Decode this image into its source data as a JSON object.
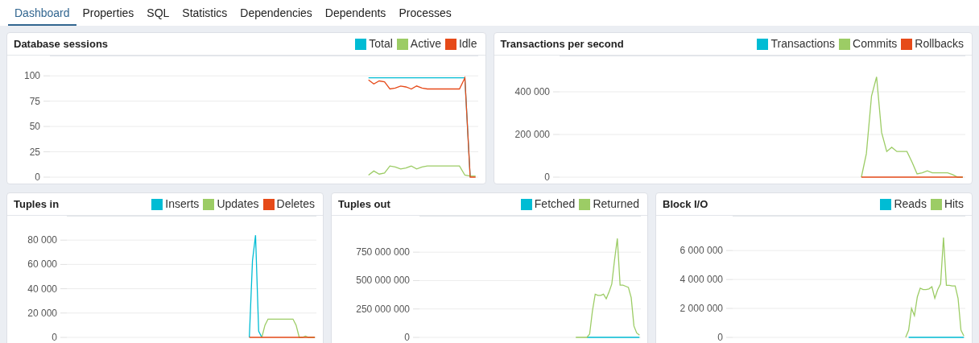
{
  "tabs": [
    {
      "label": "Dashboard",
      "selected": true
    },
    {
      "label": "Properties",
      "selected": false
    },
    {
      "label": "SQL",
      "selected": false
    },
    {
      "label": "Statistics",
      "selected": false
    },
    {
      "label": "Dependencies",
      "selected": false
    },
    {
      "label": "Dependents",
      "selected": false
    },
    {
      "label": "Processes",
      "selected": false
    }
  ],
  "rows": [
    {
      "panels": [
        {
          "title": "Database sessions",
          "chart_data": {
            "type": "line",
            "grid": true,
            "categories": [
              null,
              null,
              null,
              null,
              null,
              null,
              null,
              null,
              null,
              null,
              null,
              null,
              null,
              null,
              null,
              null,
              null,
              null,
              null,
              null,
              null,
              null,
              null,
              null,
              null,
              null,
              null,
              null,
              null,
              null,
              null,
              null,
              null,
              null,
              null,
              null,
              null,
              null,
              null,
              null,
              null,
              null,
              null,
              null,
              null,
              null,
              null,
              null,
              null,
              null,
              null,
              null,
              null,
              null,
              null,
              null,
              null,
              null,
              null,
              null,
              null,
              null,
              null,
              null,
              null,
              null,
              null,
              null,
              null,
              null,
              null,
              null,
              null,
              null,
              null,
              null,
              null,
              null,
              null,
              null
            ],
            "ylim": [
              0,
              120
            ],
            "yticks": [
              {
                "value": 0,
                "label": "0"
              },
              {
                "value": 25,
                "label": "25"
              },
              {
                "value": 50,
                "label": "50"
              },
              {
                "value": 75,
                "label": "75"
              },
              {
                "value": 100,
                "label": "100"
              }
            ],
            "series": [
              {
                "name": "Total",
                "color": "#00bcd4",
                "values": [
                  null,
                  null,
                  null,
                  null,
                  null,
                  null,
                  null,
                  null,
                  null,
                  null,
                  null,
                  null,
                  null,
                  null,
                  null,
                  null,
                  null,
                  null,
                  null,
                  null,
                  null,
                  null,
                  null,
                  null,
                  null,
                  null,
                  null,
                  null,
                  null,
                  null,
                  null,
                  null,
                  null,
                  null,
                  null,
                  null,
                  null,
                  null,
                  null,
                  null,
                  null,
                  null,
                  null,
                  null,
                  null,
                  null,
                  null,
                  null,
                  null,
                  null,
                  null,
                  null,
                  null,
                  null,
                  null,
                  null,
                  null,
                  null,
                  null,
                  98,
                  98,
                  98,
                  98,
                  98,
                  98,
                  98,
                  98,
                  98,
                  98,
                  98,
                  98,
                  98,
                  98,
                  98,
                  98,
                  98,
                  98,
                  98,
                  0,
                  null
                ]
              },
              {
                "name": "Active",
                "color": "#9ccc65",
                "values": [
                  null,
                  null,
                  null,
                  null,
                  null,
                  null,
                  null,
                  null,
                  null,
                  null,
                  null,
                  null,
                  null,
                  null,
                  null,
                  null,
                  null,
                  null,
                  null,
                  null,
                  null,
                  null,
                  null,
                  null,
                  null,
                  null,
                  null,
                  null,
                  null,
                  null,
                  null,
                  null,
                  null,
                  null,
                  null,
                  null,
                  null,
                  null,
                  null,
                  null,
                  null,
                  null,
                  null,
                  null,
                  null,
                  null,
                  null,
                  null,
                  null,
                  null,
                  null,
                  null,
                  null,
                  null,
                  null,
                  null,
                  null,
                  null,
                  null,
                  2,
                  6,
                  3,
                  4,
                  11,
                  10,
                  8,
                  9,
                  11,
                  8,
                  10,
                  11,
                  11,
                  11,
                  11,
                  11,
                  11,
                  11,
                  2,
                  1,
                  1
                ]
              },
              {
                "name": "Idle",
                "color": "#e64a19",
                "values": [
                  null,
                  null,
                  null,
                  null,
                  null,
                  null,
                  null,
                  null,
                  null,
                  null,
                  null,
                  null,
                  null,
                  null,
                  null,
                  null,
                  null,
                  null,
                  null,
                  null,
                  null,
                  null,
                  null,
                  null,
                  null,
                  null,
                  null,
                  null,
                  null,
                  null,
                  null,
                  null,
                  null,
                  null,
                  null,
                  null,
                  null,
                  null,
                  null,
                  null,
                  null,
                  null,
                  null,
                  null,
                  null,
                  null,
                  null,
                  null,
                  null,
                  null,
                  null,
                  null,
                  null,
                  null,
                  null,
                  null,
                  null,
                  null,
                  null,
                  96,
                  92,
                  95,
                  94,
                  87,
                  88,
                  90,
                  89,
                  87,
                  90,
                  88,
                  87,
                  87,
                  87,
                  87,
                  87,
                  87,
                  87,
                  98,
                  0,
                  0
                ]
              }
            ]
          }
        },
        {
          "title": "Transactions per second",
          "chart_data": {
            "type": "line",
            "grid": true,
            "categories": [
              null,
              null,
              null,
              null,
              null,
              null,
              null,
              null,
              null,
              null,
              null,
              null,
              null,
              null,
              null,
              null,
              null,
              null,
              null,
              null,
              null,
              null,
              null,
              null,
              null,
              null,
              null,
              null,
              null,
              null,
              null,
              null,
              null,
              null,
              null,
              null,
              null,
              null,
              null,
              null,
              null,
              null,
              null,
              null,
              null,
              null,
              null,
              null,
              null,
              null,
              null,
              null,
              null,
              null,
              null,
              null,
              null,
              null,
              null,
              null,
              null,
              null,
              null,
              null,
              null,
              null,
              null,
              null,
              null,
              null,
              null,
              null,
              null,
              null,
              null,
              null,
              null,
              null,
              null,
              null
            ],
            "ylim": [
              0,
              570000
            ],
            "yticks": [
              {
                "value": 0,
                "label": "0"
              },
              {
                "value": 200000,
                "label": "200 000"
              },
              {
                "value": 400000,
                "label": "400 000"
              }
            ],
            "series": [
              {
                "name": "Transactions",
                "color": "#00bcd4",
                "values": [
                  null,
                  null,
                  null,
                  null,
                  null,
                  null,
                  null,
                  null,
                  null,
                  null,
                  null,
                  null,
                  null,
                  null,
                  null,
                  null,
                  null,
                  null,
                  null,
                  null,
                  null,
                  null,
                  null,
                  null,
                  null,
                  null,
                  null,
                  null,
                  null,
                  null,
                  null,
                  null,
                  null,
                  null,
                  null,
                  null,
                  null,
                  null,
                  null,
                  null,
                  null,
                  null,
                  null,
                  null,
                  null,
                  null,
                  null,
                  null,
                  null,
                  null,
                  null,
                  null,
                  null,
                  null,
                  null,
                  null,
                  null,
                  null,
                  null,
                  null,
                  null,
                  null,
                  null,
                  null,
                  null,
                  null,
                  null,
                  null,
                  null,
                  null,
                  null,
                  null,
                  null,
                  null,
                  null,
                  null,
                  null,
                  null,
                  null,
                  null
                ]
              },
              {
                "name": "Commits",
                "color": "#9ccc65",
                "values": [
                  null,
                  null,
                  null,
                  null,
                  null,
                  null,
                  null,
                  null,
                  null,
                  null,
                  null,
                  null,
                  null,
                  null,
                  null,
                  null,
                  null,
                  null,
                  null,
                  null,
                  null,
                  null,
                  null,
                  null,
                  null,
                  null,
                  null,
                  null,
                  null,
                  null,
                  null,
                  null,
                  null,
                  null,
                  null,
                  null,
                  null,
                  null,
                  null,
                  null,
                  null,
                  null,
                  null,
                  null,
                  null,
                  null,
                  null,
                  null,
                  null,
                  null,
                  null,
                  null,
                  null,
                  null,
                  null,
                  null,
                  null,
                  null,
                  null,
                  0,
                  110000,
                  380000,
                  470000,
                  210000,
                  120000,
                  140000,
                  120000,
                  120000,
                  120000,
                  70000,
                  15000,
                  20000,
                  30000,
                  20000,
                  20000,
                  20000,
                  20000,
                  12000,
                  0,
                  0
                ]
              },
              {
                "name": "Rollbacks",
                "color": "#e64a19",
                "values": [
                  null,
                  null,
                  null,
                  null,
                  null,
                  null,
                  null,
                  null,
                  null,
                  null,
                  null,
                  null,
                  null,
                  null,
                  null,
                  null,
                  null,
                  null,
                  null,
                  null,
                  null,
                  null,
                  null,
                  null,
                  null,
                  null,
                  null,
                  null,
                  null,
                  null,
                  null,
                  null,
                  null,
                  null,
                  null,
                  null,
                  null,
                  null,
                  null,
                  null,
                  null,
                  null,
                  null,
                  null,
                  null,
                  null,
                  null,
                  null,
                  null,
                  null,
                  null,
                  null,
                  null,
                  null,
                  null,
                  null,
                  null,
                  null,
                  null,
                  0,
                  0,
                  0,
                  0,
                  0,
                  0,
                  0,
                  0,
                  0,
                  0,
                  0,
                  0,
                  0,
                  0,
                  0,
                  0,
                  0,
                  0,
                  0,
                  0,
                  0
                ]
              }
            ]
          }
        }
      ]
    },
    {
      "panels": [
        {
          "title": "Tuples in",
          "chart_data": {
            "type": "line",
            "grid": true,
            "categories": [
              null,
              null,
              null,
              null,
              null,
              null,
              null,
              null,
              null,
              null,
              null,
              null,
              null,
              null,
              null,
              null,
              null,
              null,
              null,
              null,
              null,
              null,
              null,
              null,
              null,
              null,
              null,
              null,
              null,
              null,
              null,
              null,
              null,
              null,
              null,
              null,
              null,
              null,
              null,
              null,
              null,
              null,
              null,
              null,
              null,
              null,
              null,
              null,
              null,
              null,
              null,
              null,
              null,
              null,
              null,
              null,
              null,
              null,
              null,
              null,
              null,
              null,
              null,
              null,
              null,
              null,
              null,
              null,
              null,
              null,
              null,
              null,
              null,
              null,
              null,
              null,
              null,
              null,
              null,
              null
            ],
            "ylim": [
              0,
              100000
            ],
            "yticks": [
              {
                "value": 0,
                "label": "0"
              },
              {
                "value": 20000,
                "label": "20 000"
              },
              {
                "value": 40000,
                "label": "40 000"
              },
              {
                "value": 60000,
                "label": "60 000"
              },
              {
                "value": 80000,
                "label": "80 000"
              }
            ],
            "series": [
              {
                "name": "Inserts",
                "color": "#00bcd4",
                "values": [
                  null,
                  null,
                  null,
                  null,
                  null,
                  null,
                  null,
                  null,
                  null,
                  null,
                  null,
                  null,
                  null,
                  null,
                  null,
                  null,
                  null,
                  null,
                  null,
                  null,
                  null,
                  null,
                  null,
                  null,
                  null,
                  null,
                  null,
                  null,
                  null,
                  null,
                  null,
                  null,
                  null,
                  null,
                  null,
                  null,
                  null,
                  null,
                  null,
                  null,
                  null,
                  null,
                  null,
                  null,
                  null,
                  null,
                  null,
                  null,
                  null,
                  null,
                  null,
                  null,
                  null,
                  null,
                  null,
                  null,
                  null,
                  null,
                  0,
                  63000,
                  84000,
                  5000,
                  0,
                  null,
                  null,
                  null,
                  null,
                  null,
                  null,
                  null,
                  null,
                  null,
                  null,
                  null,
                  null,
                  null,
                  null,
                  null,
                  null,
                  null
                ]
              },
              {
                "name": "Updates",
                "color": "#9ccc65",
                "values": [
                  null,
                  null,
                  null,
                  null,
                  null,
                  null,
                  null,
                  null,
                  null,
                  null,
                  null,
                  null,
                  null,
                  null,
                  null,
                  null,
                  null,
                  null,
                  null,
                  null,
                  null,
                  null,
                  null,
                  null,
                  null,
                  null,
                  null,
                  null,
                  null,
                  null,
                  null,
                  null,
                  null,
                  null,
                  null,
                  null,
                  null,
                  null,
                  null,
                  null,
                  null,
                  null,
                  null,
                  null,
                  null,
                  null,
                  null,
                  null,
                  null,
                  null,
                  null,
                  null,
                  null,
                  null,
                  null,
                  null,
                  null,
                  null,
                  null,
                  null,
                  null,
                  null,
                  0,
                  10000,
                  15000,
                  15000,
                  15000,
                  15000,
                  15000,
                  15000,
                  15000,
                  15000,
                  15000,
                  10000,
                  0,
                  0,
                  1000,
                  0,
                  0,
                  0
                ]
              },
              {
                "name": "Deletes",
                "color": "#e64a19",
                "values": [
                  null,
                  null,
                  null,
                  null,
                  null,
                  null,
                  null,
                  null,
                  null,
                  null,
                  null,
                  null,
                  null,
                  null,
                  null,
                  null,
                  null,
                  null,
                  null,
                  null,
                  null,
                  null,
                  null,
                  null,
                  null,
                  null,
                  null,
                  null,
                  null,
                  null,
                  null,
                  null,
                  null,
                  null,
                  null,
                  null,
                  null,
                  null,
                  null,
                  null,
                  null,
                  null,
                  null,
                  null,
                  null,
                  null,
                  null,
                  null,
                  null,
                  null,
                  null,
                  null,
                  null,
                  null,
                  null,
                  null,
                  null,
                  null,
                  0,
                  0,
                  0,
                  0,
                  0,
                  0,
                  0,
                  0,
                  0,
                  0,
                  0,
                  0,
                  0,
                  0,
                  0,
                  0,
                  0,
                  0,
                  0,
                  0,
                  0,
                  0
                ]
              }
            ]
          }
        },
        {
          "title": "Tuples out",
          "chart_data": {
            "type": "line",
            "grid": true,
            "categories": [
              null,
              null,
              null,
              null,
              null,
              null,
              null,
              null,
              null,
              null,
              null,
              null,
              null,
              null,
              null,
              null,
              null,
              null,
              null,
              null,
              null,
              null,
              null,
              null,
              null,
              null,
              null,
              null,
              null,
              null,
              null,
              null,
              null,
              null,
              null,
              null,
              null,
              null,
              null,
              null,
              null,
              null,
              null,
              null,
              null,
              null,
              null,
              null,
              null,
              null,
              null,
              null,
              null,
              null,
              null,
              null,
              null,
              null,
              null,
              null,
              null,
              null,
              null,
              null,
              null,
              null,
              null,
              null,
              null,
              null,
              null,
              null,
              null,
              null,
              null,
              null,
              null,
              null,
              null,
              null
            ],
            "ylim": [
              0,
              1070000000
            ],
            "yticks": [
              {
                "value": 0,
                "label": "0"
              },
              {
                "value": 250000000,
                "label": "250 000 000"
              },
              {
                "value": 500000000,
                "label": "500 000 000"
              },
              {
                "value": 750000000,
                "label": "750 000 000"
              }
            ],
            "series": [
              {
                "name": "Fetched",
                "color": "#00bcd4",
                "values": [
                  null,
                  null,
                  null,
                  null,
                  null,
                  null,
                  null,
                  null,
                  null,
                  null,
                  null,
                  null,
                  null,
                  null,
                  null,
                  null,
                  null,
                  null,
                  null,
                  null,
                  null,
                  null,
                  null,
                  null,
                  null,
                  null,
                  null,
                  null,
                  null,
                  null,
                  null,
                  null,
                  null,
                  null,
                  null,
                  null,
                  null,
                  null,
                  null,
                  null,
                  null,
                  null,
                  null,
                  null,
                  null,
                  null,
                  null,
                  null,
                  null,
                  null,
                  null,
                  null,
                  null,
                  null,
                  null,
                  null,
                  null,
                  null,
                  null,
                  null,
                  0,
                  0,
                  0,
                  0,
                  0,
                  0,
                  0,
                  0,
                  0,
                  0,
                  0,
                  0,
                  0,
                  0,
                  0,
                  0,
                  0,
                  0,
                  0,
                  0
                ]
              },
              {
                "name": "Returned",
                "color": "#9ccc65",
                "values": [
                  null,
                  null,
                  null,
                  null,
                  null,
                  null,
                  null,
                  null,
                  null,
                  null,
                  null,
                  null,
                  null,
                  null,
                  null,
                  null,
                  null,
                  null,
                  null,
                  null,
                  null,
                  null,
                  null,
                  null,
                  null,
                  null,
                  null,
                  null,
                  null,
                  null,
                  null,
                  null,
                  null,
                  null,
                  null,
                  null,
                  null,
                  null,
                  null,
                  null,
                  null,
                  null,
                  null,
                  null,
                  null,
                  null,
                  null,
                  null,
                  null,
                  null,
                  null,
                  null,
                  null,
                  null,
                  null,
                  null,
                  0,
                  0,
                  0,
                  0,
                  0,
                  30000000,
                  230000000,
                  380000000,
                  370000000,
                  370000000,
                  380000000,
                  340000000,
                  400000000,
                  470000000,
                  680000000,
                  870000000,
                  460000000,
                  460000000,
                  450000000,
                  440000000,
                  350000000,
                  100000000,
                  40000000,
                  20000000
                ]
              }
            ]
          }
        },
        {
          "title": "Block I/O",
          "chart_data": {
            "type": "line",
            "grid": true,
            "categories": [
              null,
              null,
              null,
              null,
              null,
              null,
              null,
              null,
              null,
              null,
              null,
              null,
              null,
              null,
              null,
              null,
              null,
              null,
              null,
              null,
              null,
              null,
              null,
              null,
              null,
              null,
              null,
              null,
              null,
              null,
              null,
              null,
              null,
              null,
              null,
              null,
              null,
              null,
              null,
              null,
              null,
              null,
              null,
              null,
              null,
              null,
              null,
              null,
              null,
              null,
              null,
              null,
              null,
              null,
              null,
              null,
              null,
              null,
              null,
              null,
              null,
              null,
              null,
              null,
              null,
              null,
              null,
              null,
              null,
              null,
              null,
              null,
              null,
              null,
              null,
              null,
              null,
              null,
              null,
              null
            ],
            "ylim": [
              0,
              8400000
            ],
            "yticks": [
              {
                "value": 0,
                "label": "0"
              },
              {
                "value": 2000000,
                "label": "2 000 000"
              },
              {
                "value": 4000000,
                "label": "4 000 000"
              },
              {
                "value": 6000000,
                "label": "6 000 000"
              }
            ],
            "series": [
              {
                "name": "Reads",
                "color": "#00bcd4",
                "values": [
                  null,
                  null,
                  null,
                  null,
                  null,
                  null,
                  null,
                  null,
                  null,
                  null,
                  null,
                  null,
                  null,
                  null,
                  null,
                  null,
                  null,
                  null,
                  null,
                  null,
                  null,
                  null,
                  null,
                  null,
                  null,
                  null,
                  null,
                  null,
                  null,
                  null,
                  null,
                  null,
                  null,
                  null,
                  null,
                  null,
                  null,
                  null,
                  null,
                  null,
                  null,
                  null,
                  null,
                  null,
                  null,
                  null,
                  null,
                  null,
                  null,
                  null,
                  null,
                  null,
                  null,
                  null,
                  null,
                  null,
                  null,
                  null,
                  null,
                  null,
                  0,
                  0,
                  0,
                  0,
                  0,
                  0,
                  0,
                  0,
                  0,
                  0,
                  0,
                  0,
                  0,
                  0,
                  0,
                  0,
                  0,
                  0,
                  0,
                  0
                ]
              },
              {
                "name": "Hits",
                "color": "#9ccc65",
                "values": [
                  null,
                  null,
                  null,
                  null,
                  null,
                  null,
                  null,
                  null,
                  null,
                  null,
                  null,
                  null,
                  null,
                  null,
                  null,
                  null,
                  null,
                  null,
                  null,
                  null,
                  null,
                  null,
                  null,
                  null,
                  null,
                  null,
                  null,
                  null,
                  null,
                  null,
                  null,
                  null,
                  null,
                  null,
                  null,
                  null,
                  null,
                  null,
                  null,
                  null,
                  null,
                  null,
                  null,
                  null,
                  null,
                  null,
                  null,
                  null,
                  null,
                  null,
                  null,
                  null,
                  null,
                  null,
                  null,
                  null,
                  null,
                  null,
                  null,
                  0,
                  500000,
                  2000000,
                  1500000,
                  2800000,
                  3400000,
                  3300000,
                  3300000,
                  3350000,
                  3500000,
                  2700000,
                  3300000,
                  3700000,
                  6900000,
                  3600000,
                  3600000,
                  3550000,
                  3550000,
                  2700000,
                  500000,
                  100000
                ]
              }
            ]
          }
        }
      ]
    }
  ]
}
